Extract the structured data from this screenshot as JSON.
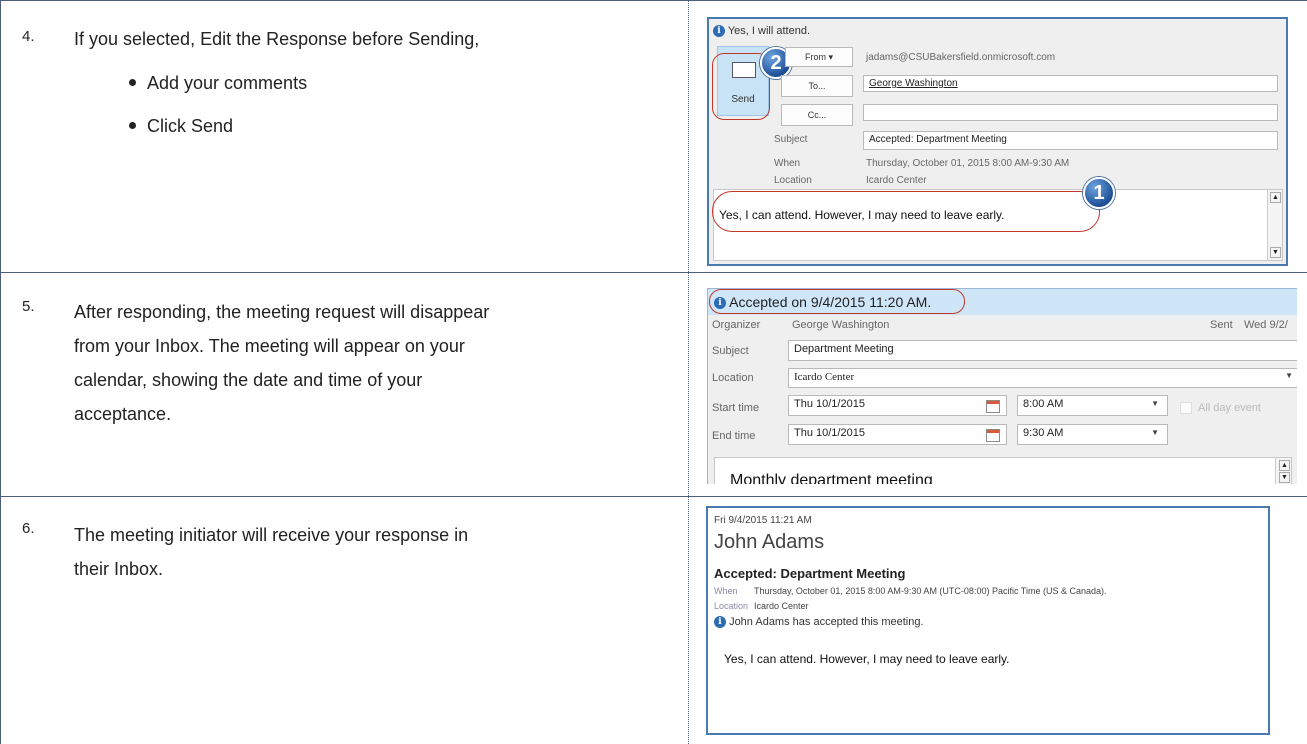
{
  "steps": [
    {
      "number": "4.",
      "text": "If you selected, Edit the Response before Sending,",
      "bullets": [
        "Add your comments",
        "Click Send"
      ]
    },
    {
      "number": "5.",
      "text_lines": [
        "After responding, the meeting request will disappear",
        "from your Inbox. The meeting will appear on your",
        "calendar, showing the date and time of your",
        "acceptance."
      ]
    },
    {
      "number": "6.",
      "text_lines": [
        "The meeting initiator will receive your response in",
        "their Inbox."
      ]
    }
  ],
  "panel1": {
    "banner": "Yes, I will attend.",
    "send_label": "Send",
    "from_label": "From ▾",
    "from_value": "jadams@CSUBakersfield.onmicrosoft.com",
    "to_label": "To...",
    "to_value": "George Washington",
    "cc_label": "Cc...",
    "cc_value": "",
    "subject_label": "Subject",
    "subject_value": "Accepted: Department Meeting",
    "when_label": "When",
    "when_value": "Thursday, October 01, 2015 8:00 AM-9:30 AM",
    "location_label": "Location",
    "location_value": "Icardo Center",
    "body": "Yes, I can attend. However, I may need to leave early.",
    "badge1": "1",
    "badge2": "2"
  },
  "panel2": {
    "banner": "Accepted on 9/4/2015 11:20 AM.",
    "organizer_label": "Organizer",
    "organizer_value": "George Washington",
    "sent_label": "Sent",
    "sent_value": "Wed 9/2/",
    "subject_label": "Subject",
    "subject_value": "Department Meeting",
    "location_label": "Location",
    "location_value": "Icardo Center",
    "start_label": "Start time",
    "start_date": "Thu 10/1/2015",
    "start_time": "8:00 AM",
    "allday_label": "All day event",
    "end_label": "End time",
    "end_date": "Thu 10/1/2015",
    "end_time": "9:30 AM",
    "body": "Monthly department meeting"
  },
  "panel3": {
    "datetime": "Fri 9/4/2015 11:21 AM",
    "sender": "John Adams",
    "subject": "Accepted: Department Meeting",
    "when_label": "When",
    "when_value": "Thursday, October 01, 2015 8:00 AM-9:30 AM (UTC-08:00) Pacific Time (US & Canada).",
    "location_label": "Location",
    "location_value": "Icardo Center",
    "info": "John Adams has accepted this meeting.",
    "body": "Yes, I can attend. However, I may need to leave early."
  },
  "colors": {
    "table_border": "#4a5f7a",
    "panel_bg": "#efefef",
    "banner_blue": "#cfe5f8",
    "send_bg": "#c9e3f6",
    "red_oval": "#c0392b",
    "panel_border": "#4a79b0"
  }
}
